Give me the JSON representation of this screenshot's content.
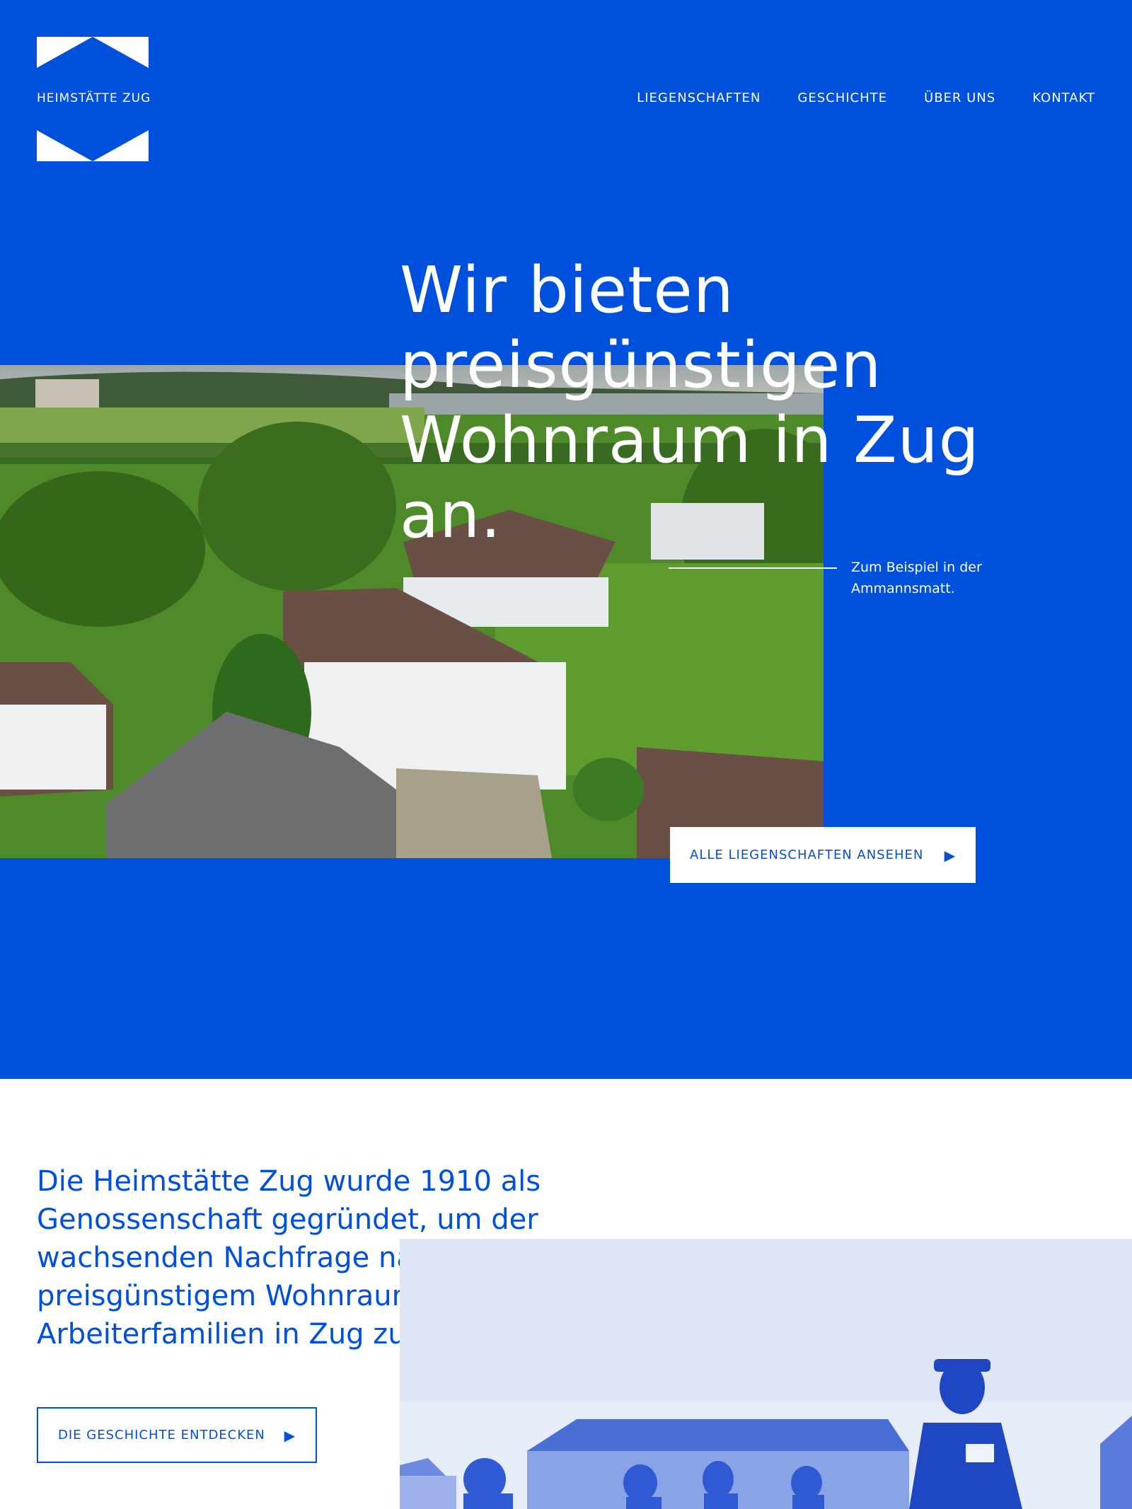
{
  "brand": {
    "name": "HEIMSTÄTTE ZUG"
  },
  "nav": {
    "items": [
      "LIEGENSCHAFTEN",
      "GESCHICHTE",
      "ÜBER UNS",
      "KONTAKT"
    ]
  },
  "hero": {
    "headline_lines": [
      "Wir bieten",
      "preisgünstigen",
      "Wohnraum in Zug an."
    ],
    "caption_lines": [
      "Zum Beispiel in der",
      "Ammannsmatt."
    ],
    "button_label": "ALLE LIEGENSCHAFTEN ANSEHEN",
    "button_icon": "play-triangle-icon"
  },
  "history": {
    "intro": "Die Heimstätte Zug wurde 1910 als Genossenschaft gegründet, um der wachsenden Nachfrage nach preisgünstigem Wohnraum für Arbeiterfamilien in Zug zu begegnen.",
    "button_label": "DIE GESCHICHTE ENTDECKEN",
    "button_icon": "play-triangle-icon"
  },
  "colors": {
    "brand_blue": "#0050de",
    "white": "#ffffff"
  }
}
